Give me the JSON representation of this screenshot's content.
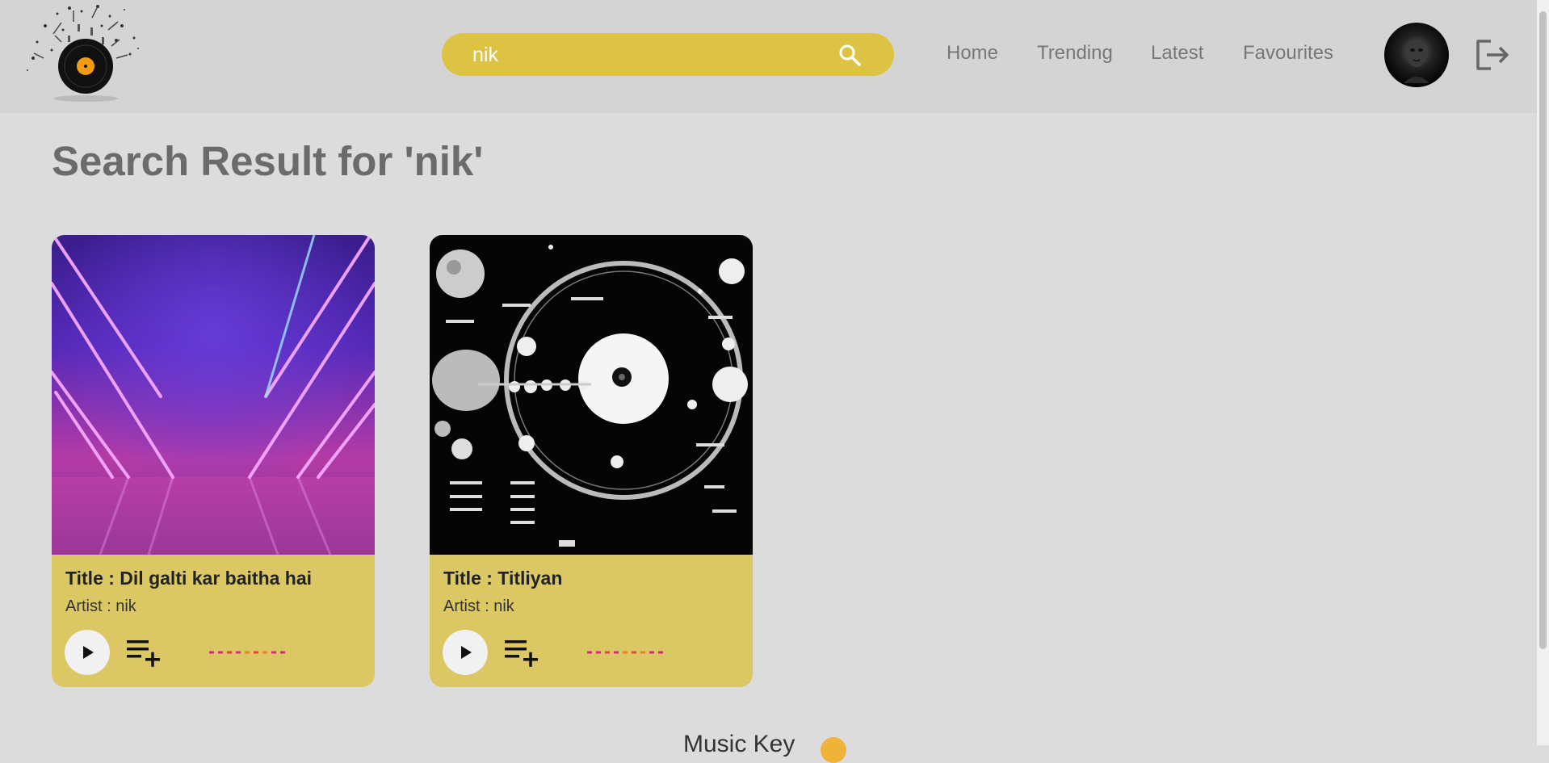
{
  "header": {
    "search": {
      "value": "nik",
      "placeholder": ""
    },
    "nav": [
      "Home",
      "Trending",
      "Latest",
      "Favourites"
    ]
  },
  "main": {
    "title": "Search Result for 'nik'",
    "cards": [
      {
        "title": "Title : Dil galti kar baitha hai",
        "artist": "Artist : nik",
        "art": "neon-stage-art"
      },
      {
        "title": "Title : Titliyan",
        "artist": "Artist : nik",
        "art": "space-diagram-art"
      }
    ]
  },
  "footer": {
    "text": "Music Key"
  },
  "colors": {
    "accent": "#dcc343",
    "card": "#dcc765",
    "background": "#dcdcdc",
    "header": "#d4d4d4",
    "wave_colors": [
      "#e0218a",
      "#e8433a",
      "#ef7d22"
    ]
  },
  "icons": [
    "vinyl-logo-icon",
    "search-icon",
    "logout-icon",
    "play-icon",
    "playlist-add-icon",
    "waveform-icon",
    "smile-emoji-icon"
  ]
}
